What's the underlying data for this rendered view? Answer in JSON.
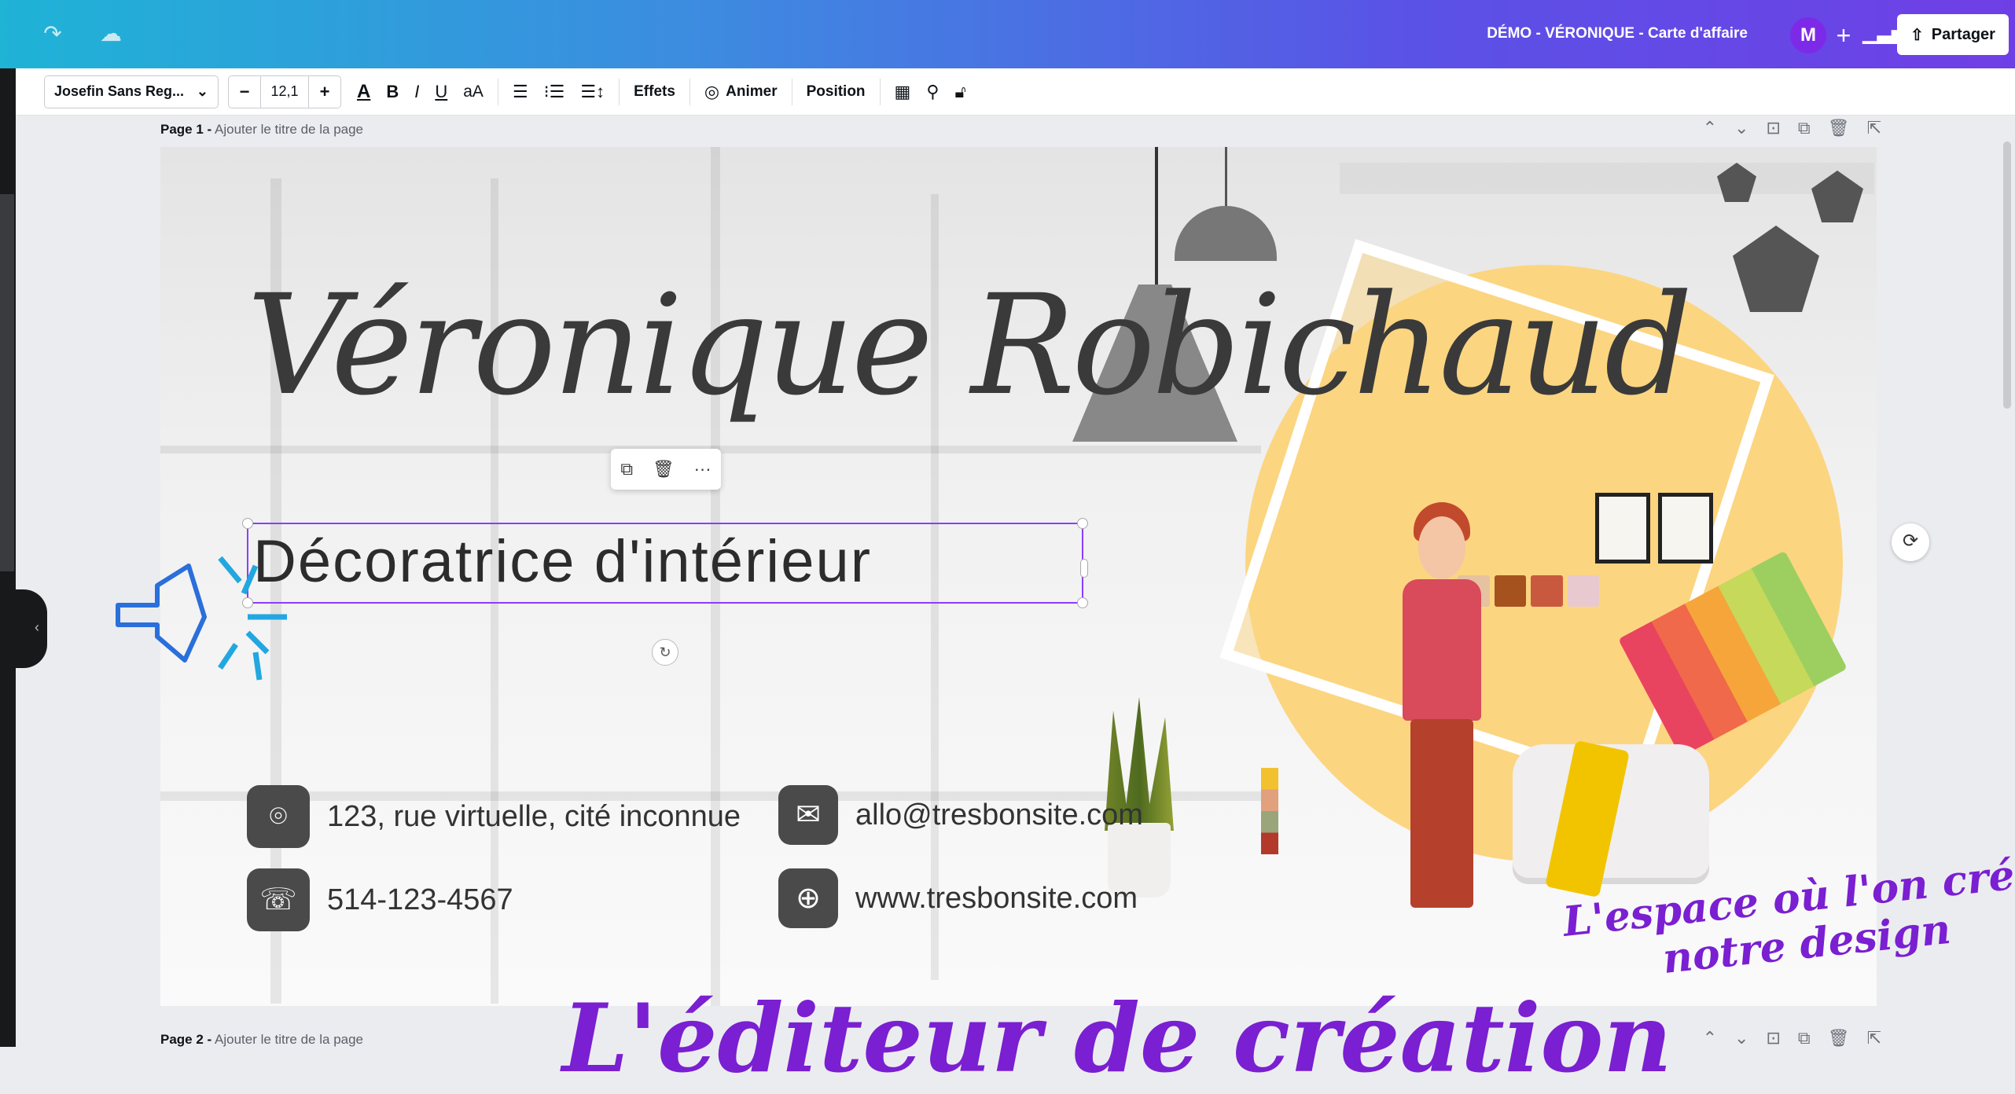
{
  "header": {
    "title": "DÉMO - VÉRONIQUE - Carte d'affaire",
    "avatar_initial": "M",
    "add_label": "+",
    "share_label": "Partager",
    "icons": [
      "redo-icon",
      "cloud-sync-icon",
      "stats-icon",
      "share-icon"
    ]
  },
  "toolbar": {
    "font_name": "Josefin Sans Reg...",
    "size_decrease": "−",
    "font_size": "12,1",
    "size_increase": "+",
    "text_color_label": "A",
    "bold_label": "B",
    "italic_label": "I",
    "underline_label": "U",
    "case_label": "aA",
    "effects_label": "Effets",
    "animate_label": "Animer",
    "position_label": "Position"
  },
  "pages": [
    {
      "label": "Page 1 -",
      "subtitle": "Ajouter le titre de la page"
    },
    {
      "label": "Page 2 -",
      "subtitle": "Ajouter le titre de la page"
    }
  ],
  "card": {
    "name": "Véronique Robichaud",
    "title": "Décoratrice d'intérieur",
    "address": "123, rue virtuelle, cité inconnue",
    "phone": "514-123-4567",
    "email": "allo@tresbonsite.com",
    "website": "www.tresbonsite.com"
  },
  "annotations": {
    "side_line1": "L'espace où l'on crée",
    "side_line2": "notre design",
    "bottom": "L'éditeur de création"
  },
  "colors": {
    "header_gradient_start": "#1fb3d6",
    "header_gradient_end": "#6f3fe6",
    "selection": "#8b3dff",
    "annotation": "#7a1fd1",
    "accent_circle": "#fcd581"
  }
}
